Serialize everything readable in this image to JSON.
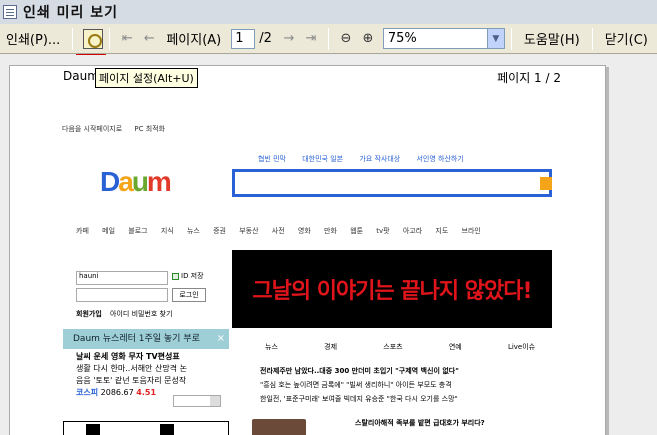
{
  "window": {
    "title": "인쇄 미리 보기"
  },
  "toolbar": {
    "print_label": "인쇄(P)...",
    "page_label": "페이지(A)",
    "page_current": "1",
    "page_total": "/2",
    "zoom": "75%",
    "help_label": "도움말(H)",
    "close_label": "닫기(C)"
  },
  "sheet": {
    "header_left": "Daum - Life On Daum",
    "header_right": "페이지 1 / 2",
    "tooltip": "페이지 설정(Alt+U)"
  },
  "daum": {
    "top_links": [
      "다음을 시작페이지로",
      "PC 최적화"
    ],
    "logo": [
      "D",
      "a",
      "u",
      "m"
    ],
    "issues": [
      "협빈 민막",
      "대한민국 일본",
      "가요 작사대상",
      "서인영 하산하기"
    ],
    "categories": [
      "카페",
      "메일",
      "블로그",
      "지식",
      "뉴스",
      "증권",
      "부동산",
      "사전",
      "영화",
      "만화",
      "웹툰",
      "tv팟",
      "아고라",
      "지도",
      "브라인"
    ],
    "login_id": "hauni",
    "save_id": "ID 저장",
    "login_button": "로그인",
    "login_links": [
      "회원가입",
      "아이디",
      "비밀번호 찾기"
    ],
    "banner": "그날의 이야기는 끝나지 않았다!",
    "toast": "Daum 뉴스레터 1주일 놓기 부로",
    "left_links": [
      "날씨  운세  영화  무자  TV편성표",
      "생활   다시 한마..서해안 산망격 논",
      "음음  '토토' 같넌 토음자리 문성작"
    ],
    "stock_label": "코스피",
    "stock_value": "2086.67",
    "stock_change": "4.51",
    "news_tabs": [
      "뉴스",
      "경제",
      "스포츠",
      "연예",
      "Live이슈"
    ],
    "news_headline": "전라제주만 남았다..대중 300 만더미 초입기   \"구제역 백신이 없다\"",
    "news_lines": [
      "\"흥심 호는 높이려면 금록에\"   \"빌써 생리하니\" 아이든 부모도 충격",
      "한일전, '표준구미래' 보여줄 빅데지   유승준 \"한국 다시 오기를 스망\""
    ],
    "news_bottom": "스탈리아해적 족부를 밭편 급대호가 부리다?"
  }
}
